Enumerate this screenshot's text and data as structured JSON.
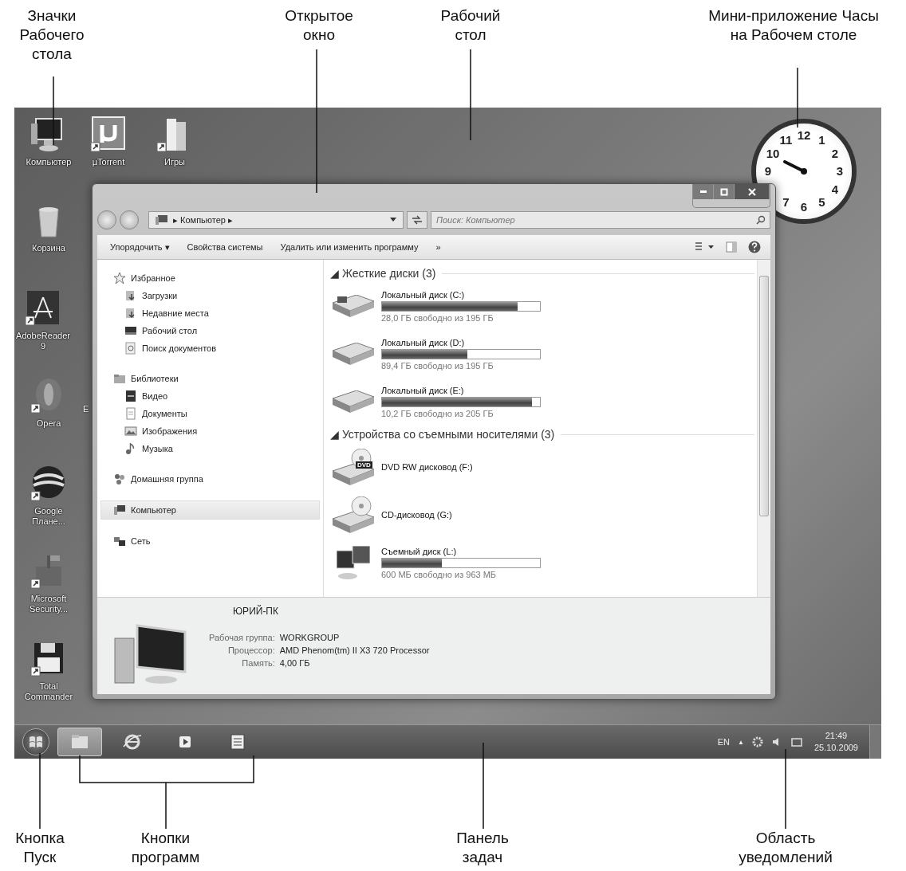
{
  "annotations_top": [
    {
      "text": "Значки\nРабочего\nстола"
    },
    {
      "text": "Открытое\nокно"
    },
    {
      "text": "Рабочий\nстол"
    },
    {
      "text": "Мини-приложение Часы\nна Рабочем столе"
    }
  ],
  "desktop": {
    "icons": [
      {
        "label": "Компьютер",
        "kind": "computer"
      },
      {
        "label": "µTorrent",
        "kind": "torrent"
      },
      {
        "label": "Игры",
        "kind": "folder"
      },
      {
        "label": "Корзина",
        "kind": "bin"
      },
      {
        "label": "AdobeReader\n9",
        "kind": "reader"
      },
      {
        "label": "Opera",
        "kind": "opera"
      },
      {
        "label": "Google\nПлане...",
        "kind": "globe"
      },
      {
        "label": "Microsoft\nSecurity...",
        "kind": "castle"
      },
      {
        "label": "Total\nCommander",
        "kind": "floppy"
      }
    ],
    "cut_label": "E"
  },
  "window": {
    "nav": {
      "breadcrumb": "▸ Компьютер ▸",
      "search_placeholder": "Поиск: Компьютер"
    },
    "toolbar": [
      "Упорядочить ▾",
      "Свойства системы",
      "Удалить или изменить программу",
      "»"
    ],
    "sidebar": [
      {
        "label": "Избранное",
        "kind": "star",
        "selected": false,
        "children": [
          {
            "label": "Загрузки",
            "kind": "download",
            "selected": false
          },
          {
            "label": "Недавние места",
            "kind": "recent",
            "selected": false
          },
          {
            "label": "Рабочий стол",
            "kind": "desktop",
            "selected": false
          },
          {
            "label": "Поиск документов",
            "kind": "search",
            "selected": false
          }
        ]
      },
      {
        "label": "Библиотеки",
        "kind": "library",
        "selected": false,
        "children": [
          {
            "label": "Видео",
            "kind": "video",
            "selected": false
          },
          {
            "label": "Документы",
            "kind": "document",
            "selected": false
          },
          {
            "label": "Изображения",
            "kind": "image",
            "selected": false
          },
          {
            "label": "Музыка",
            "kind": "music",
            "selected": false
          }
        ]
      },
      {
        "label": "Домашняя группа",
        "kind": "homegroup",
        "selected": false
      },
      {
        "label": "Компьютер",
        "kind": "computer",
        "selected": true
      },
      {
        "label": "Сеть",
        "kind": "network",
        "selected": false
      }
    ],
    "groups": [
      {
        "title": "◢ Жесткие диски (3)",
        "items": [
          {
            "name": "Локальный диск (C:)",
            "kind": "system",
            "level": 0.86,
            "reading": "28,0 ГБ свободно из 195 ГБ"
          },
          {
            "name": "Локальный диск (D:)",
            "kind": "disk",
            "level": 0.54,
            "reading": "89,4 ГБ свободно из 195 ГБ"
          },
          {
            "name": "Локальный диск (E:)",
            "kind": "disk",
            "level": 0.95,
            "reading": "10,2 ГБ свободно из 205 ГБ"
          }
        ]
      },
      {
        "title": "◢ Устройства со съемными носителями (3)",
        "items": [
          {
            "name": "DVD RW дисковод (F:)",
            "kind": "dvd",
            "badge": "DVD"
          },
          {
            "name": "CD-дисковод (G:)",
            "kind": "cd"
          },
          {
            "name": "Съемный диск (L:)",
            "kind": "removable",
            "level": 0.38,
            "reading": "600 МБ свободно из 963 МБ"
          }
        ]
      }
    ],
    "details": {
      "name": "ЮРИЙ-ПК",
      "rows": [
        {
          "label": "Рабочая группа:",
          "value": "WORKGROUP"
        },
        {
          "label": "Процессор:",
          "value": "AMD Phenom(tm) II X3 720 Processor"
        },
        {
          "label": "Память:",
          "value": "4,00 ГБ"
        }
      ]
    }
  },
  "clock": {
    "numerals": [
      "12",
      "1",
      "2",
      "3",
      "4",
      "5",
      "6",
      "7",
      "9",
      "10",
      "11"
    ]
  },
  "taskbar": {
    "programs": [
      {
        "kind": "explorer",
        "selected": true
      },
      {
        "kind": "browser",
        "selected": false
      },
      {
        "kind": "player",
        "selected": false
      },
      {
        "kind": "word",
        "selected": false
      }
    ],
    "language": "EN",
    "tray_arrow": "▲",
    "time": "21:49",
    "date": "25.10.2009"
  },
  "annotations_bottom": [
    {
      "text": "Кнопка\nПуск"
    },
    {
      "text": "Кнопки\nпрограмм"
    },
    {
      "text": "Панель\nзадач"
    },
    {
      "text": "Область\nуведомлений"
    }
  ]
}
